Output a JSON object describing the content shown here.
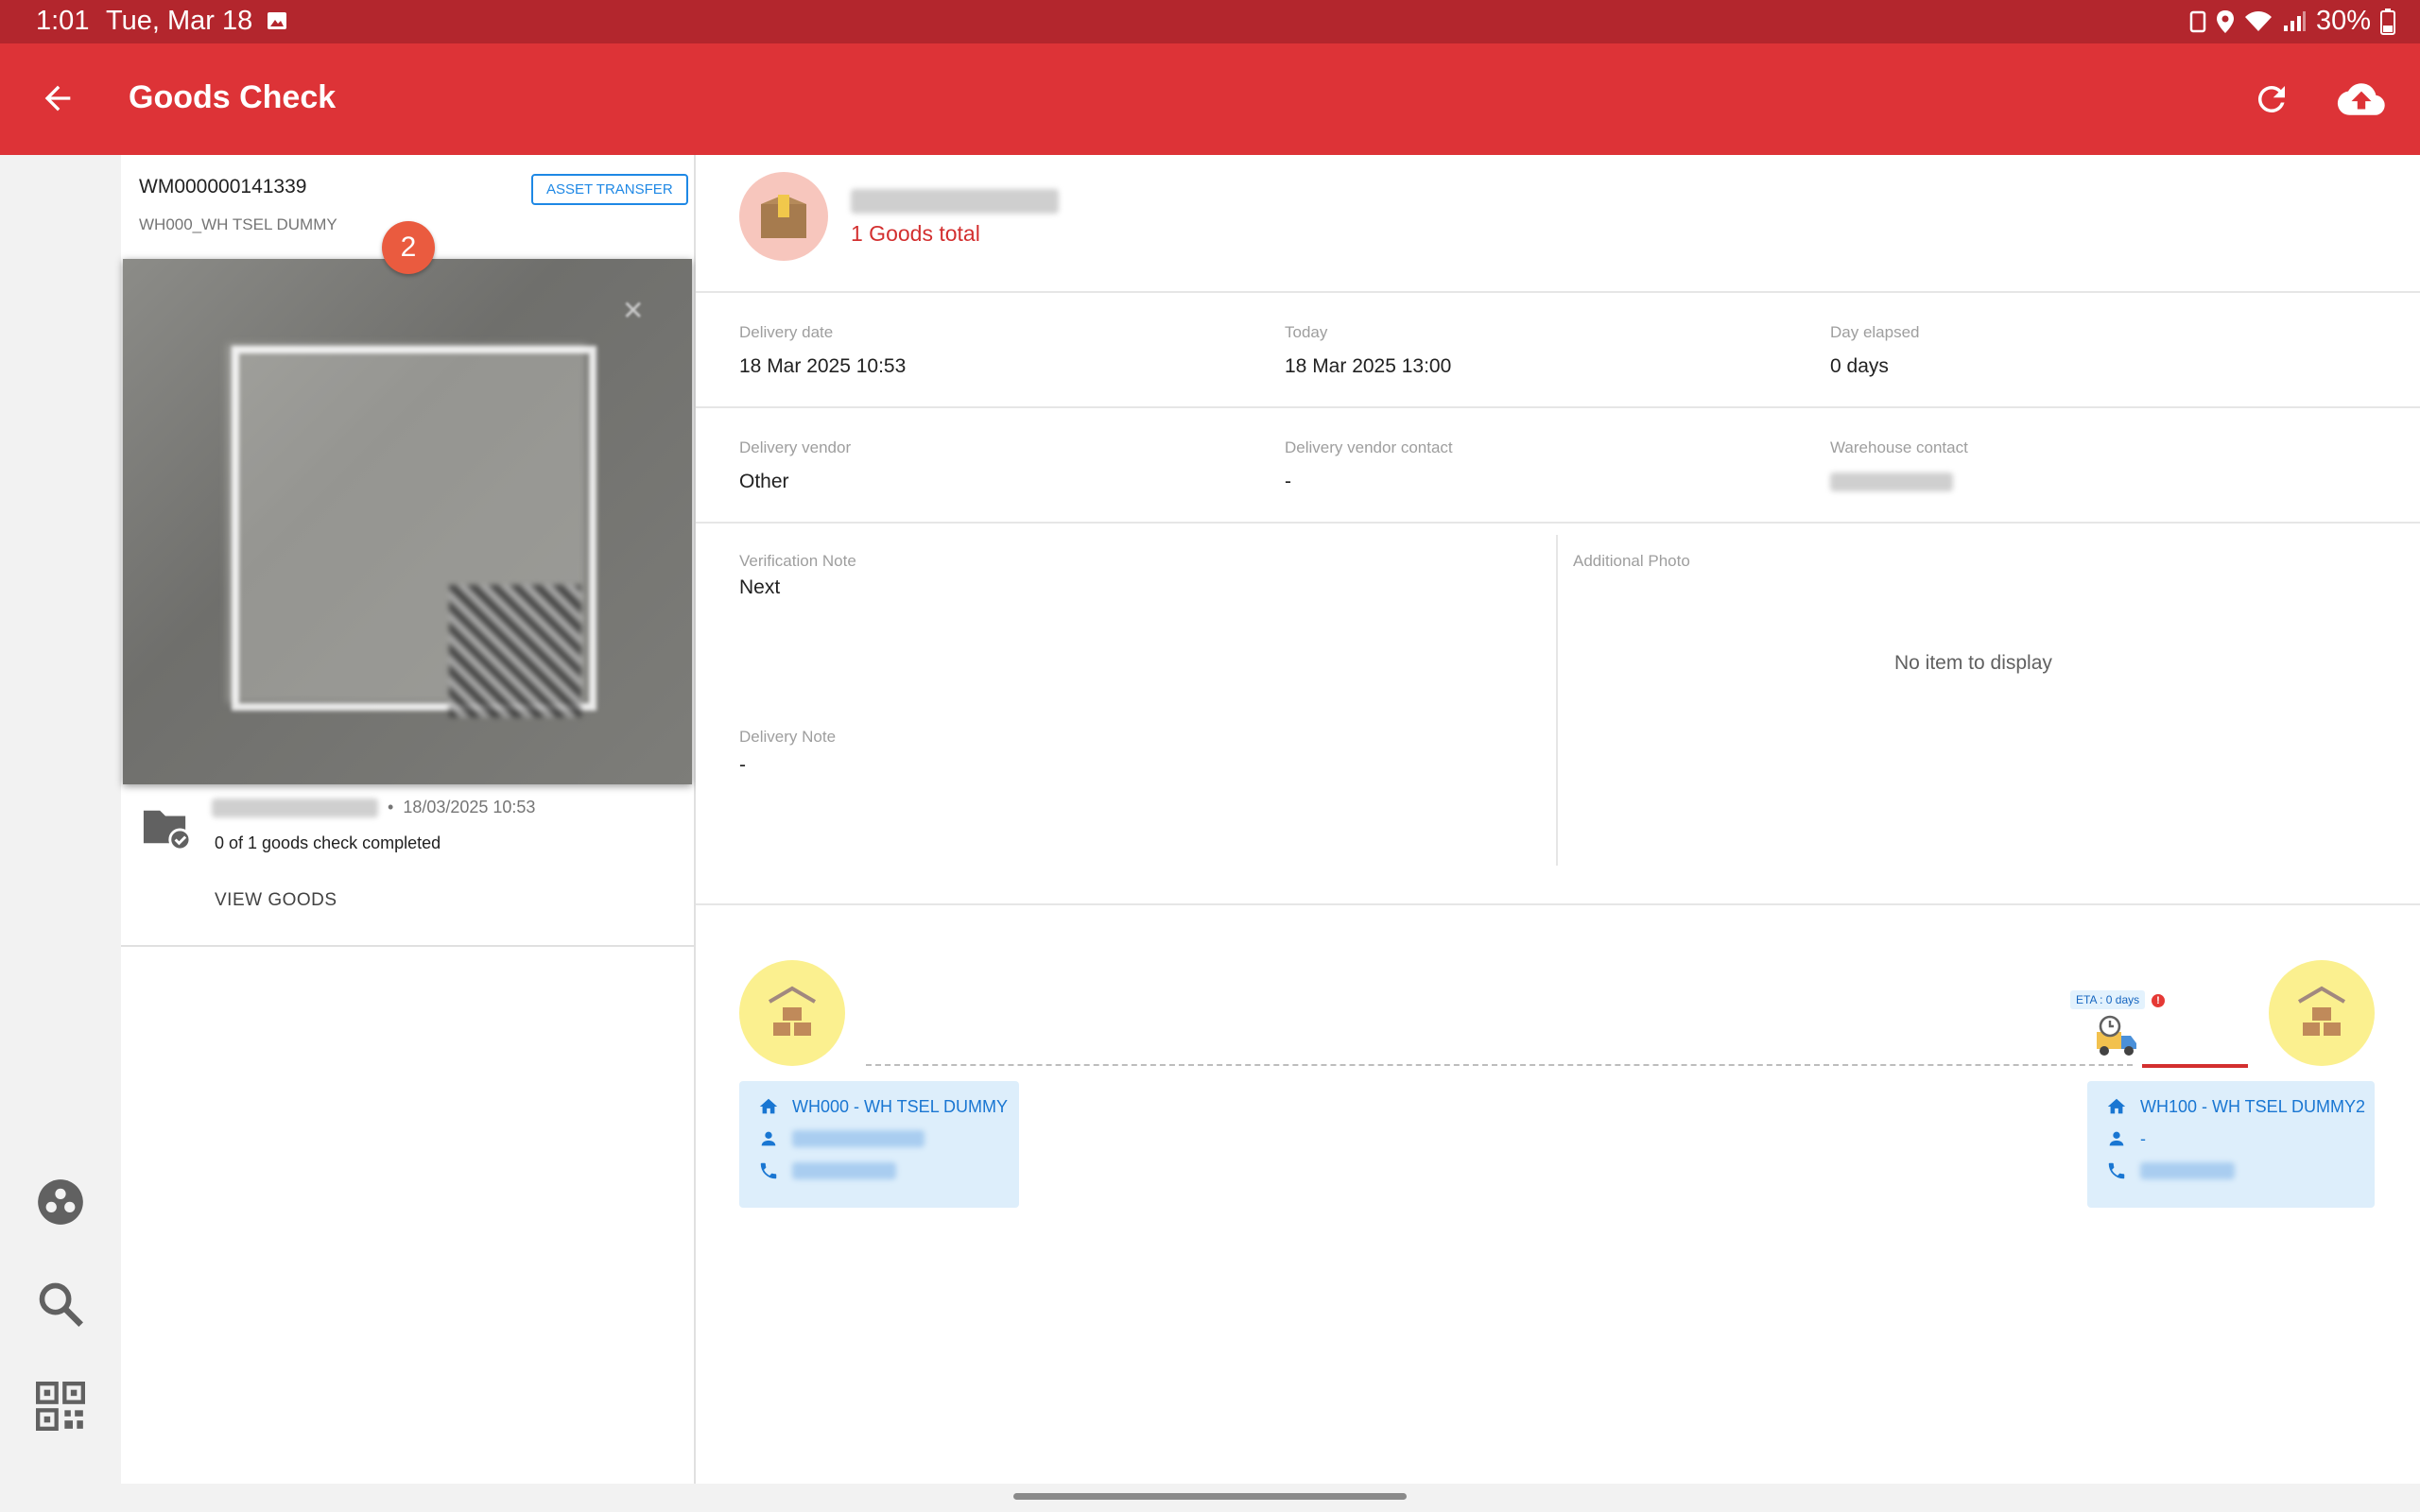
{
  "status": {
    "time": "1:01",
    "date": "Tue, Mar 18",
    "battery": "30%"
  },
  "appbar": {
    "title": "Goods Check"
  },
  "list": {
    "card": {
      "id": "WM000000141339",
      "badge": "ASSET TRANSFER",
      "warehouse": "WH000_WH TSEL DUMMY"
    },
    "marker": "2",
    "goods": {
      "date": "18/03/2025 10:53",
      "progress": "0 of  1 goods check completed",
      "view_label": "VIEW GOODS"
    }
  },
  "detail": {
    "goods_total": "1 Goods total",
    "delivery_date_label": "Delivery date",
    "delivery_date": "18 Mar 2025 10:53",
    "today_label": "Today",
    "today": "18 Mar 2025 13:00",
    "elapsed_label": "Day elapsed",
    "elapsed": "0 days",
    "vendor_label": "Delivery vendor",
    "vendor": "Other",
    "vendor_contact_label": "Delivery vendor contact",
    "vendor_contact": "-",
    "wh_contact_label": "Warehouse contact",
    "verification_label": "Verification Note",
    "verification": "Next",
    "delivery_note_label": "Delivery Note",
    "delivery_note": "-",
    "photo_label": "Additional Photo",
    "no_item": "No item to display"
  },
  "route": {
    "eta": "ETA : 0 days",
    "origin": {
      "name": "WH000 - WH TSEL DUMMY"
    },
    "destination": {
      "name": "WH100 - WH TSEL DUMMY2",
      "person": "-"
    }
  },
  "colors": {
    "appbar": "#dd3337",
    "statusbar": "#b3262d",
    "accent_blue": "#1976d2",
    "accent_red": "#d32f2f"
  },
  "icons": [
    "back-arrow-icon",
    "refresh-icon",
    "cloud-upload-icon",
    "group-icon",
    "search-icon",
    "qr-code-icon",
    "folder-check-icon",
    "package-icon",
    "warehouse-icon",
    "truck-icon",
    "home-icon",
    "person-icon",
    "phone-icon"
  ]
}
